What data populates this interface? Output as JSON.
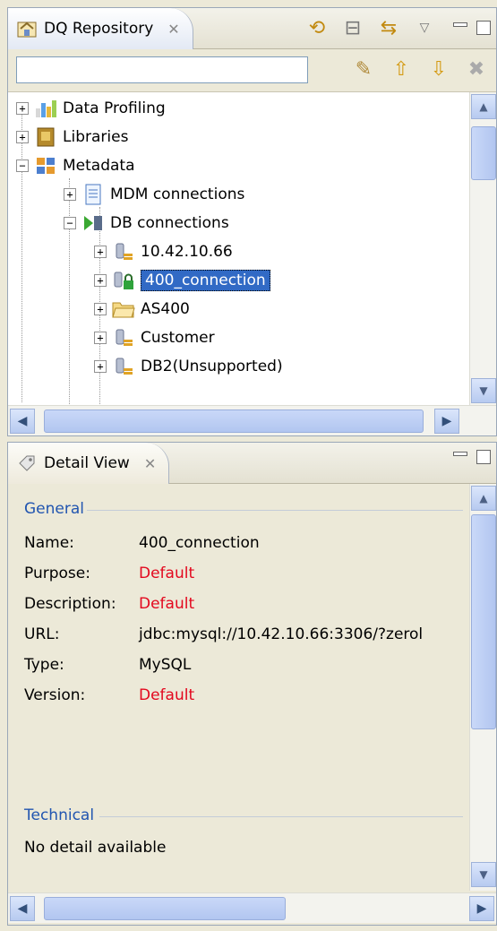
{
  "repository": {
    "tab_title": "DQ Repository",
    "search_placeholder": "",
    "tree": {
      "data_profiling": "Data Profiling",
      "libraries": "Libraries",
      "metadata": "Metadata",
      "mdm_connections": "MDM connections",
      "db_connections": "DB connections",
      "conn_1": "10.42.10.66",
      "conn_2": "400_connection",
      "conn_3": "AS400",
      "conn_4": "Customer",
      "conn_5": "DB2(Unsupported)"
    }
  },
  "detail": {
    "tab_title": "Detail View",
    "general_label": "General",
    "name_key": "Name:",
    "name_val": "400_connection",
    "purpose_key": "Purpose:",
    "purpose_val": "Default",
    "description_key": "Description:",
    "description_val": "Default",
    "url_key": "URL:",
    "url_val": "jdbc:mysql://10.42.10.66:3306/?zerol",
    "type_key": "Type:",
    "type_val": "MySQL",
    "version_key": "Version:",
    "version_val": "Default",
    "technical_label": "Technical",
    "technical_text": "No detail available"
  },
  "colors": {
    "selection": "#316ac5",
    "default_value": "#e3081e",
    "section_title": "#2155b0"
  }
}
